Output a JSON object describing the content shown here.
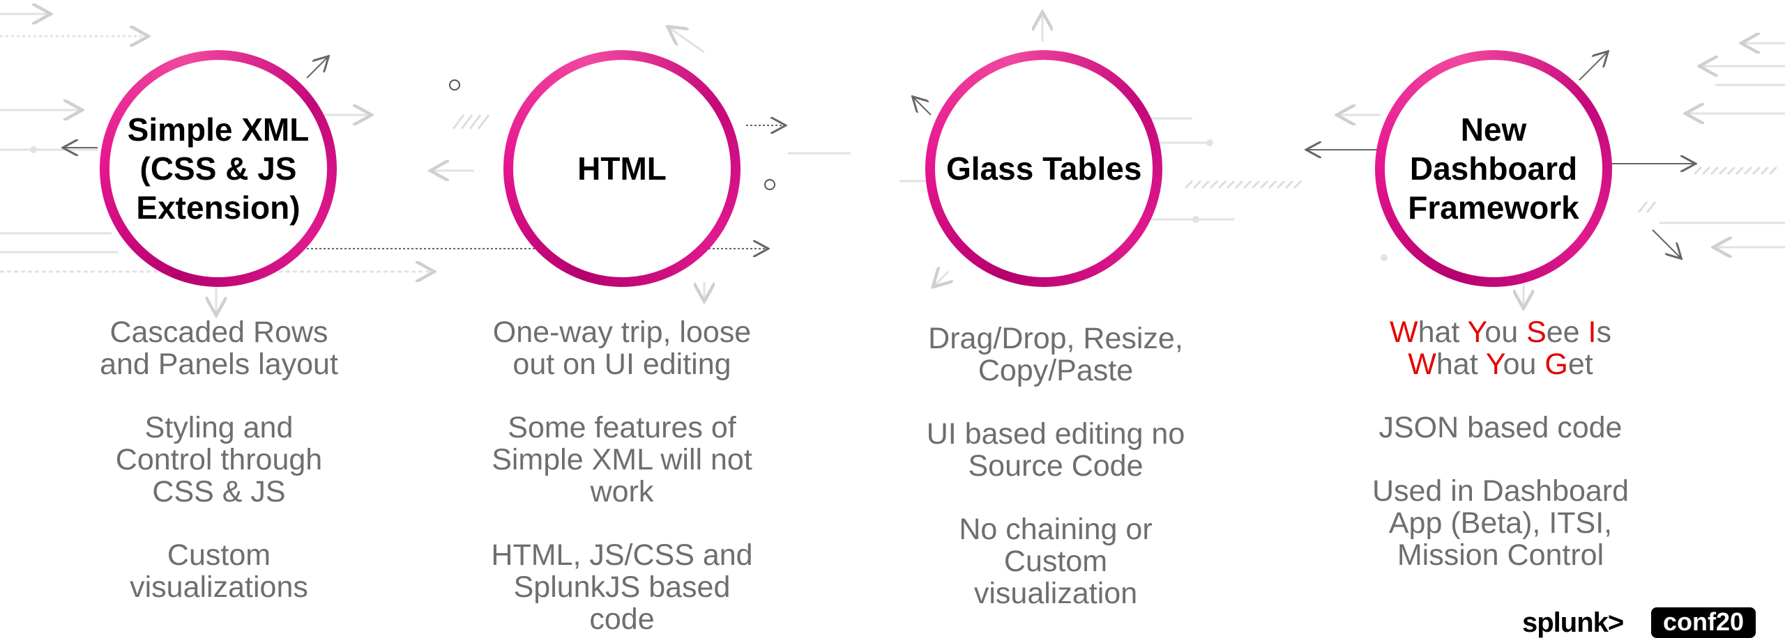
{
  "columns": [
    {
      "title_lines": [
        "Simple XML",
        "(CSS & JS",
        "Extension)"
      ],
      "items": [
        [
          "Cascaded Rows",
          "and Panels layout"
        ],
        [
          "Styling and",
          "Control through",
          "CSS & JS"
        ],
        [
          "Custom",
          "visualizations"
        ]
      ]
    },
    {
      "title_lines": [
        "HTML"
      ],
      "items": [
        [
          "One-way trip, loose",
          "out on UI editing"
        ],
        [
          "Some features of",
          "Simple XML will not",
          "work"
        ],
        [
          "HTML, JS/CSS and",
          "SplunkJS based",
          "code"
        ]
      ]
    },
    {
      "title_lines": [
        "Glass Tables"
      ],
      "items": [
        [
          "Drag/Drop, Resize,",
          "Copy/Paste"
        ],
        [
          "UI based editing no",
          "Source Code"
        ],
        [
          "No chaining or",
          "Custom",
          "visualization"
        ]
      ]
    },
    {
      "title_lines": [
        "New",
        "Dashboard",
        "Framework"
      ],
      "wysiwyg": {
        "line1": [
          {
            "t": "W",
            "hl": true
          },
          {
            "t": "hat ",
            "hl": false
          },
          {
            "t": "Y",
            "hl": true
          },
          {
            "t": "ou ",
            "hl": false
          },
          {
            "t": "S",
            "hl": true
          },
          {
            "t": "ee ",
            "hl": false
          },
          {
            "t": "I",
            "hl": true
          },
          {
            "t": "s",
            "hl": false
          }
        ],
        "line2": [
          {
            "t": "W",
            "hl": true
          },
          {
            "t": "hat ",
            "hl": false
          },
          {
            "t": "Y",
            "hl": true
          },
          {
            "t": "ou ",
            "hl": false
          },
          {
            "t": "G",
            "hl": true
          },
          {
            "t": "et",
            "hl": false
          }
        ]
      },
      "items": [
        [
          "JSON based code"
        ],
        [
          "Used in Dashboard",
          "App (Beta), ITSI,",
          "Mission Control"
        ]
      ]
    }
  ],
  "colors": {
    "ring_primary": "#d4137f",
    "text_gray": "#6e6e6e",
    "wysiwyg_highlight": "#e60000"
  },
  "logos": {
    "splunk": "splunk>",
    "conf": "conf20"
  }
}
